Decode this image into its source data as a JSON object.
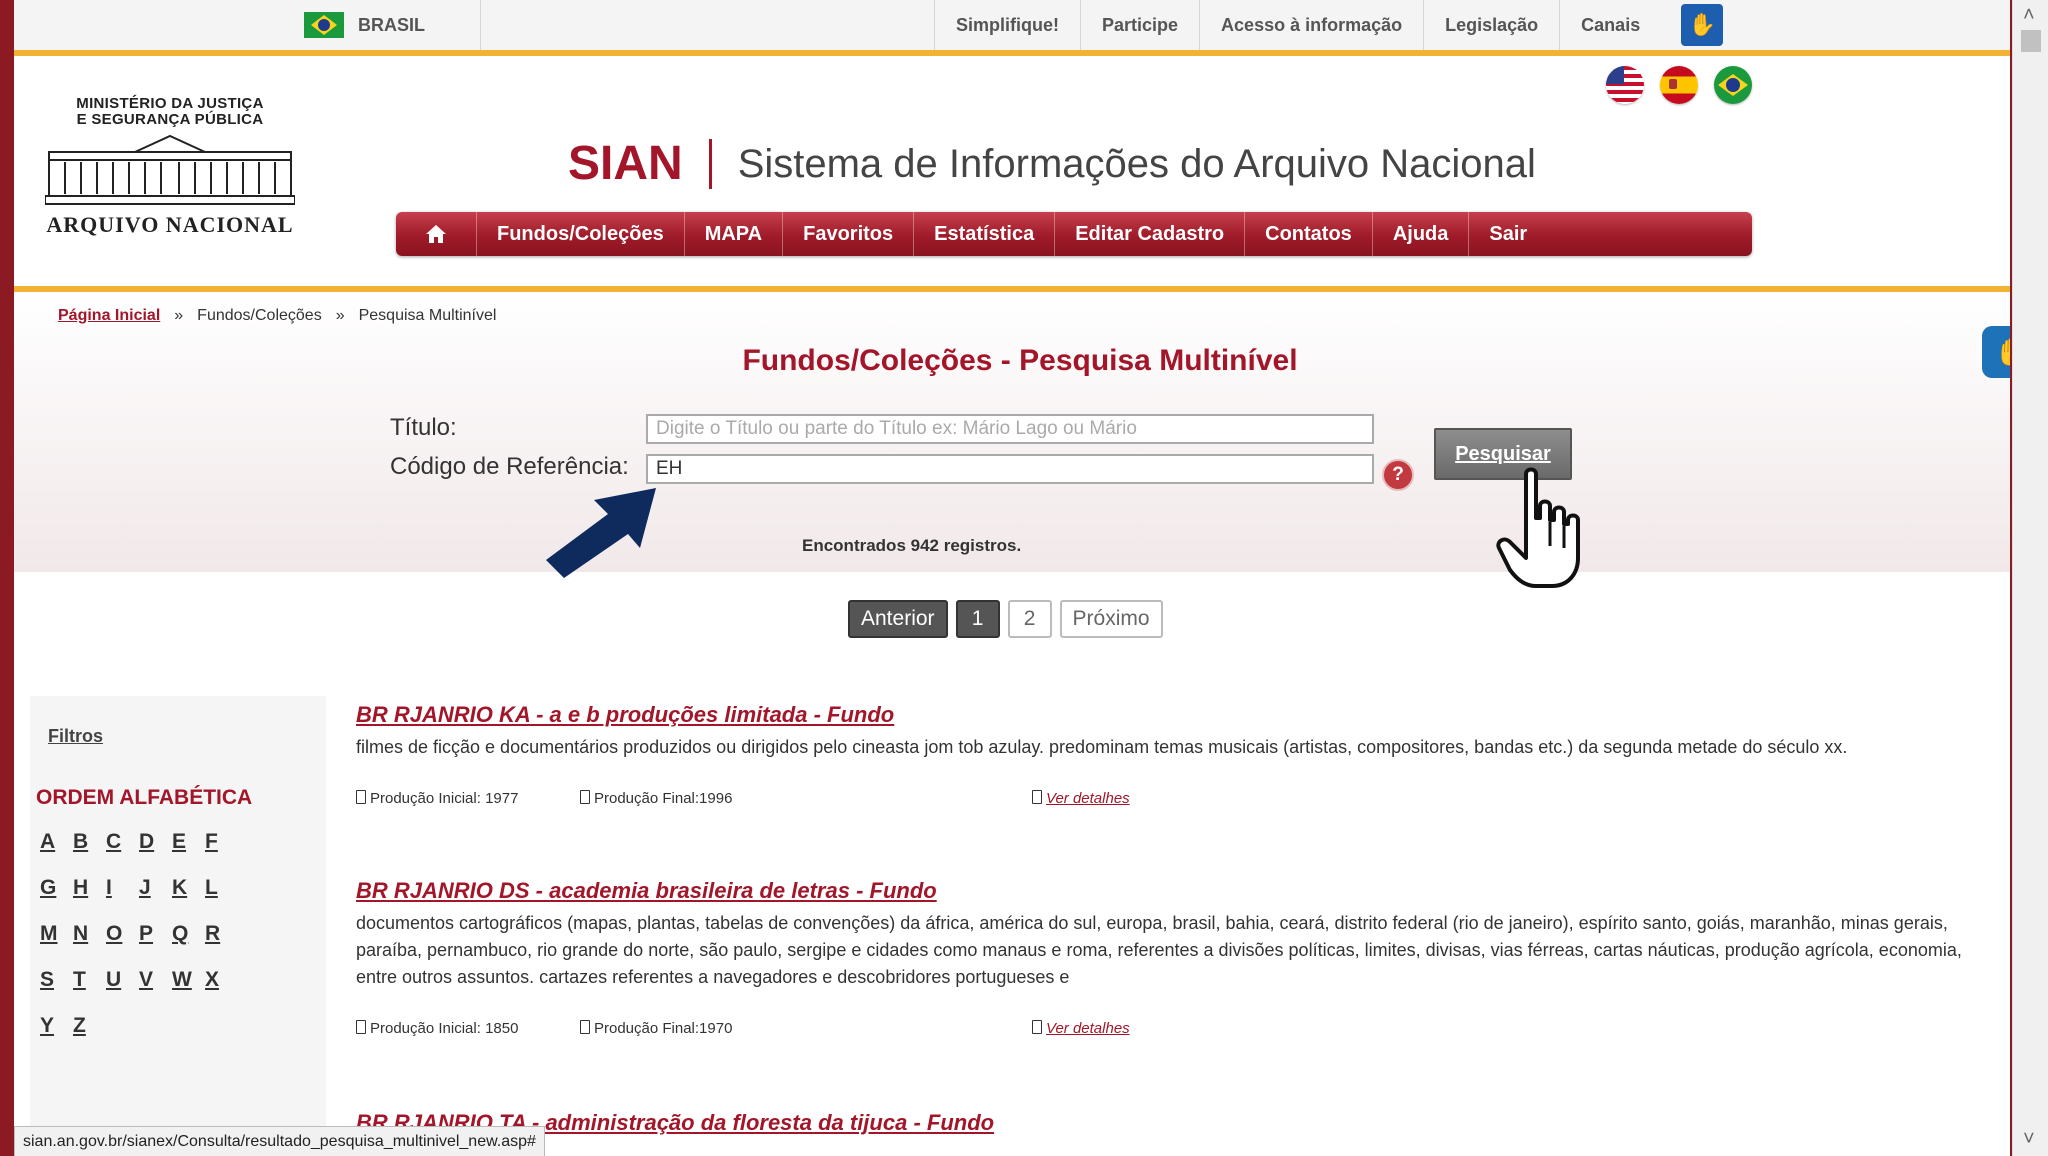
{
  "govbar": {
    "country": "BRASIL",
    "links": [
      "Simplifique!",
      "Participe",
      "Acesso à informação",
      "Legislação",
      "Canais"
    ]
  },
  "logo": {
    "ministry_line1": "MINISTÉRIO DA JUSTIÇA",
    "ministry_line2": "E SEGURANÇA PÚBLICA",
    "name": "ARQUIVO NACIONAL"
  },
  "header": {
    "code": "SIAN",
    "title": "Sistema de Informações do Arquivo Nacional"
  },
  "nav": {
    "items": [
      "Fundos/Coleções",
      "MAPA",
      "Favoritos",
      "Estatística",
      "Editar Cadastro",
      "Contatos",
      "Ajuda",
      "Sair"
    ]
  },
  "breadcrumb": {
    "home": "Página Inicial",
    "sep": "»",
    "level1": "Fundos/Coleções",
    "current": "Pesquisa Multinível"
  },
  "page_title": "Fundos/Coleções - Pesquisa Multinível",
  "search": {
    "title_label": "Título:",
    "title_placeholder": "Digite o Título ou parte do Título ex: Mário Lago ou Mário",
    "title_value": "",
    "ref_label": "Código de Referência:",
    "ref_value": "EH",
    "help": "?",
    "button": "Pesquisar"
  },
  "results_count": "Encontrados 942 registros.",
  "pager": {
    "prev": "Anterior",
    "pages": [
      "1",
      "2"
    ],
    "next": "Próximo"
  },
  "sidebar": {
    "filters": "Filtros",
    "alpha_title": "ORDEM ALFABÉTICA",
    "letters": [
      "A",
      "B",
      "C",
      "D",
      "E",
      "F",
      "G",
      "H",
      "I",
      "J",
      "K",
      "L",
      "M",
      "N",
      "O",
      "P",
      "Q",
      "R",
      "S",
      "T",
      "U",
      "V",
      "W",
      "X",
      "Y",
      "Z"
    ]
  },
  "results": [
    {
      "title": "BR RJANRIO KA - a e b produções limitada - Fundo",
      "description": "filmes de ficção e documentários produzidos ou dirigidos pelo cineasta jom tob azulay. predominam temas musicais (artistas, compositores, bandas etc.) da segunda metade do século xx.",
      "start": "Produção Inicial: 1977",
      "end": "Produção Final:1996",
      "details": "Ver detalhes"
    },
    {
      "title": "BR RJANRIO DS - academia brasileira de letras - Fundo",
      "description": "documentos cartográficos (mapas, plantas, tabelas de convenções) da áfrica, américa do sul, europa, brasil, bahia, ceará, distrito federal (rio de janeiro), espírito santo, goiás, maranhão, minas gerais, paraíba, pernambuco, rio grande do norte, são paulo, sergipe e cidades como manaus e roma, referentes a divisões políticas, limites, divisas, vias férreas, cartas náuticas, produção agrícola, economia, entre outros assuntos. cartazes referentes a navegadores e descobridores portugueses e",
      "start": "Produção Inicial: 1850",
      "end": "Produção Final:1970",
      "details": "Ver detalhes"
    },
    {
      "title": "BR RJANRIO TA - administração da floresta da tijuca - Fundo"
    }
  ],
  "status_url": "sian.an.gov.br/sianex/Consulta/resultado_pesquisa_multinivel_new.asp#",
  "colors": {
    "brand_red": "#a3162a",
    "accent_gold": "#f2b233"
  }
}
